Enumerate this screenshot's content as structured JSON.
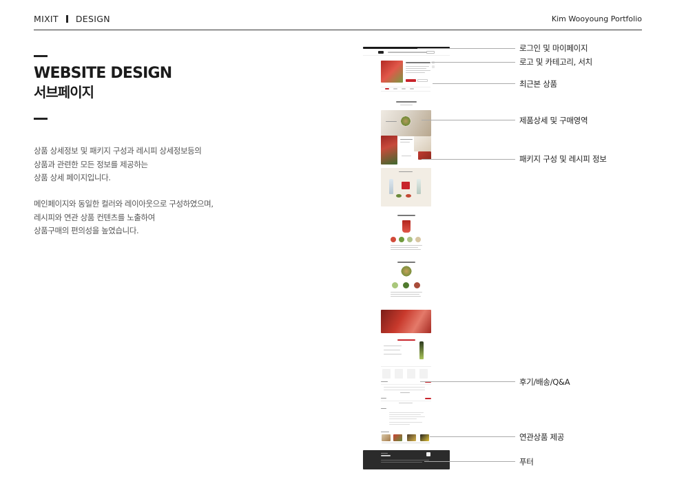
{
  "header": {
    "brand": "MIXIT",
    "section": "DESIGN",
    "portfolio": "Kim Wooyoung Portfolio"
  },
  "intro": {
    "title": "WEBSITE DESIGN",
    "subtitle": "서브페이지",
    "paragraph1": [
      "상품 상세정보 및 패키지 구성과 레시피 상세정보등의",
      "상품과 관련한 모든 정보를 제공하는",
      "상품 상세 페이지입니다."
    ],
    "paragraph2": [
      "메인페이지와 동일한 컬러와 레이아웃으로 구성하였으며,",
      "레시피와 연관 상품 컨텐츠를 노출하여",
      "상품구매의 편의성을 높였습니다."
    ]
  },
  "annotations": [
    {
      "label": "로그인 및 마이페이지"
    },
    {
      "label": "로고 및 카테고리, 서치"
    },
    {
      "label": "최근본 상품"
    },
    {
      "label": "제품상세 및 구매영역"
    },
    {
      "label": "패키지 구성 및 레시피 정보"
    },
    {
      "label": "후기/배송/Q&A"
    },
    {
      "label": "연관상품 제공"
    },
    {
      "label": "푸터"
    }
  ],
  "colors": {
    "accent_red": "#c8242b",
    "text_dark": "#222222",
    "leader_gray": "#aaaaaa",
    "footer_dark": "#2b2b2b"
  }
}
